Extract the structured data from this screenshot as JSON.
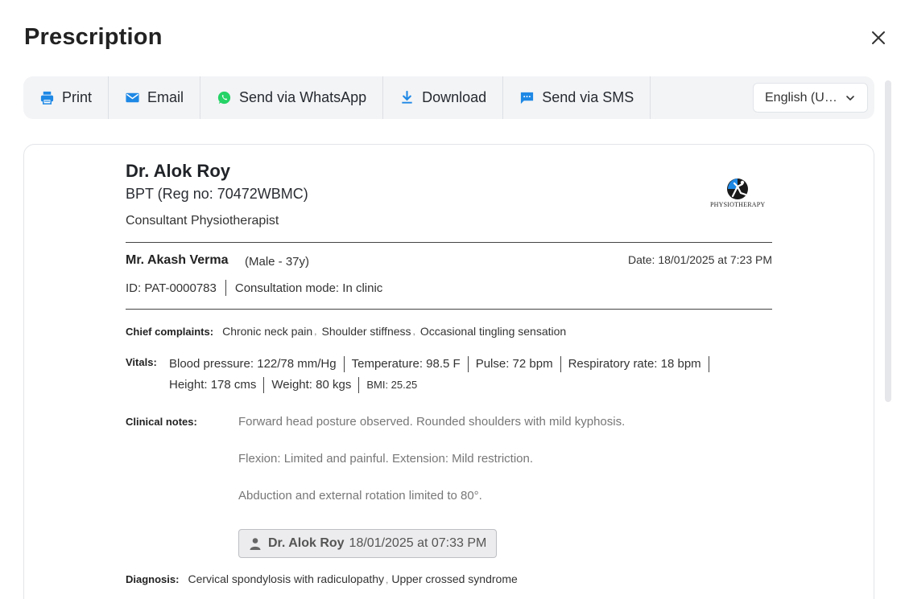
{
  "modal": {
    "title": "Prescription"
  },
  "toolbar": {
    "print_label": "Print",
    "email_label": "Email",
    "whatsapp_label": "Send via WhatsApp",
    "download_label": "Download",
    "sms_label": "Send via SMS",
    "language": "English (United States)"
  },
  "doctor": {
    "name": "Dr. Alok Roy",
    "registration": "BPT (Reg no: 70472WBMC)",
    "title": "Consultant Physiotherapist",
    "logo_text": "PHYSIOTHERAPY"
  },
  "patient": {
    "name": "Mr. Akash Verma",
    "meta": "(Male - 37y)",
    "date": "Date: 18/01/2025 at 7:23 PM",
    "id": "ID: PAT-0000783",
    "consultation_mode": "Consultation mode: In clinic"
  },
  "chief_complaints": {
    "label": "Chief complaints:",
    "items": [
      "Chronic neck pain",
      "Shoulder stiffness",
      "Occasional tingling sensation"
    ]
  },
  "vitals": {
    "label": "Vitals:",
    "items": [
      "Blood pressure: 122/78 mm/Hg",
      "Temperature: 98.5 F",
      "Pulse: 72 bpm",
      "Respiratory rate: 18 bpm",
      "Height: 178 cms",
      "Weight: 80 kgs",
      "BMI: 25.25"
    ]
  },
  "clinical_notes": {
    "label": "Clinical notes:",
    "lines": [
      "Forward head posture observed. Rounded shoulders with mild kyphosis.",
      "Flexion: Limited and painful. Extension: Mild restriction.",
      "Abduction and external rotation limited to 80°."
    ],
    "signature_name": "Dr. Alok Roy",
    "signature_time": "18/01/2025 at 07:33 PM"
  },
  "diagnosis": {
    "label": "Diagnosis:",
    "items": [
      "Cervical spondylosis with radiculopathy",
      "Upper crossed syndrome"
    ]
  },
  "colors": {
    "accent": "#1e88e5",
    "whatsapp": "#25d366",
    "text": "#222222",
    "muted": "#777777"
  }
}
